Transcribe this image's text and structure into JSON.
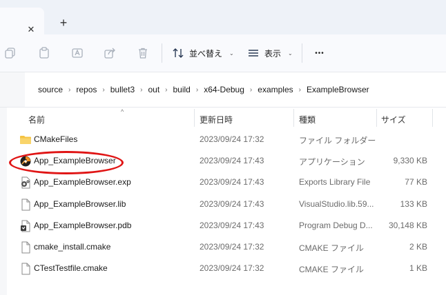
{
  "tabs": {
    "close_glyph": "✕",
    "new_tab_glyph": "+"
  },
  "toolbar": {
    "sort_label": "並べ替え",
    "view_label": "表示",
    "more_glyph": "•••"
  },
  "breadcrumb": [
    "source",
    "repos",
    "bullet3",
    "out",
    "build",
    "x64-Debug",
    "examples",
    "ExampleBrowser"
  ],
  "columns": {
    "name": "名前",
    "date": "更新日時",
    "type": "種類",
    "size": "サイズ"
  },
  "files": [
    {
      "name": "CMakeFiles",
      "date": "2023/09/24 17:32",
      "type": "ファイル フォルダー",
      "size": "",
      "icon": "folder-icon"
    },
    {
      "name": "App_ExampleBrowser",
      "date": "2023/09/24 17:43",
      "type": "アプリケーション",
      "size": "9,330 KB",
      "icon": "app-icon"
    },
    {
      "name": "App_ExampleBrowser.exp",
      "date": "2023/09/24 17:43",
      "type": "Exports Library File",
      "size": "77 KB",
      "icon": "gear-file-icon"
    },
    {
      "name": "App_ExampleBrowser.lib",
      "date": "2023/09/24 17:43",
      "type": "VisualStudio.lib.59...",
      "size": "133 KB",
      "icon": "file-icon"
    },
    {
      "name": "App_ExampleBrowser.pdb",
      "date": "2023/09/24 17:43",
      "type": "Program Debug D...",
      "size": "30,148 KB",
      "icon": "pdb-file-icon"
    },
    {
      "name": "cmake_install.cmake",
      "date": "2023/09/24 17:32",
      "type": "CMAKE ファイル",
      "size": "2 KB",
      "icon": "file-icon"
    },
    {
      "name": "CTestTestfile.cmake",
      "date": "2023/09/24 17:32",
      "type": "CMAKE ファイル",
      "size": "1 KB",
      "icon": "file-icon"
    }
  ],
  "colors": {
    "highlight_ellipse": "#e01515",
    "folder": "#f5c342",
    "accent": "#2f6fd6"
  }
}
